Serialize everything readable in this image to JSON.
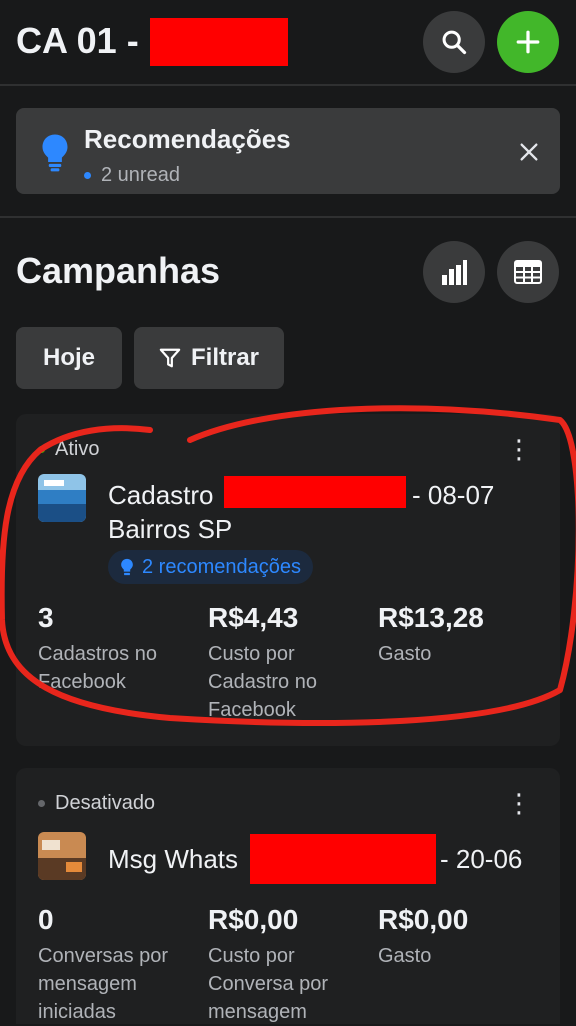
{
  "header": {
    "account_title": "CA 01 -",
    "search_icon": "search-icon",
    "add_icon": "plus-icon"
  },
  "recommendations": {
    "title": "Recomendações",
    "unread": "2 unread",
    "icon": "lightbulb-icon",
    "close_icon": "close-icon"
  },
  "campaigns_section": {
    "title": "Campanhas",
    "chart_icon": "bar-chart-icon",
    "table_icon": "table-icon",
    "today_label": "Hoje",
    "filter_label": "Filtrar",
    "filter_icon": "filter-icon"
  },
  "campaigns": [
    {
      "status": "Ativo",
      "status_color": "#44b700",
      "name_prefix": "Cadastro",
      "name_suffix": "- 08-07",
      "name_line2": "Bairros SP",
      "recommendation_chip": "2 recomendações",
      "metrics": [
        {
          "value": "3",
          "label": "Cadastros no Facebook"
        },
        {
          "value": "R$4,43",
          "label": "Custo por Cadastro no Facebook"
        },
        {
          "value": "R$13,28",
          "label": "Gasto"
        }
      ]
    },
    {
      "status": "Desativado",
      "status_color": "#65676b",
      "name_prefix": "Msg Whats",
      "name_suffix": "- 20-06",
      "metrics": [
        {
          "value": "0",
          "label": "Conversas por mensagem iniciadas"
        },
        {
          "value": "R$0,00",
          "label": "Custo por Conversa por mensagem"
        },
        {
          "value": "R$0,00",
          "label": "Gasto"
        }
      ]
    }
  ],
  "colors": {
    "background": "#18191a",
    "surface": "#3a3b3c",
    "accent_green": "#42b72a",
    "accent_blue": "#2d88ff",
    "redaction": "#ff0000",
    "annotation": "#e8261c"
  }
}
